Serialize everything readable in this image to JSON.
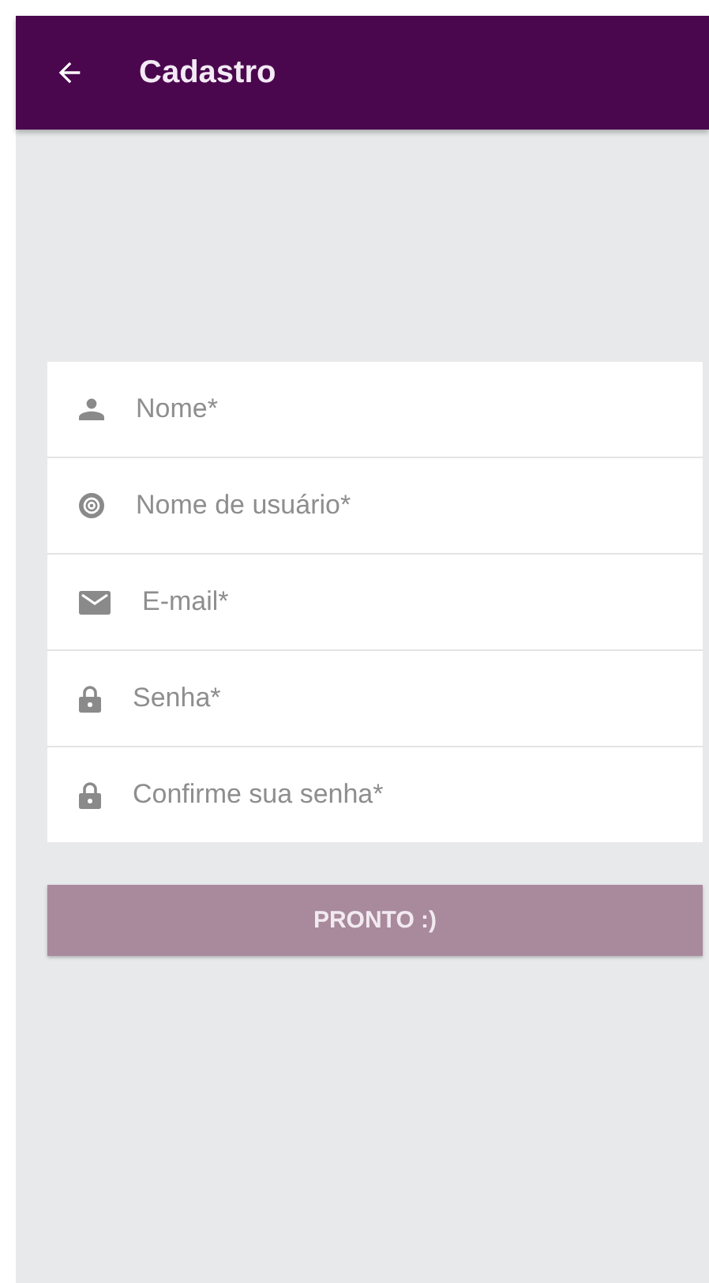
{
  "app_bar": {
    "title": "Cadastro"
  },
  "fields": [
    {
      "kind": "name",
      "placeholder": "Nome*"
    },
    {
      "kind": "username",
      "placeholder": "Nome de usuário*"
    },
    {
      "kind": "email",
      "placeholder": "E-mail*"
    },
    {
      "kind": "password",
      "placeholder": "Senha*"
    },
    {
      "kind": "password",
      "placeholder": "Confirme sua senha*"
    }
  ],
  "submit_button": {
    "label": "PRONTO :)",
    "disabled": true
  }
}
